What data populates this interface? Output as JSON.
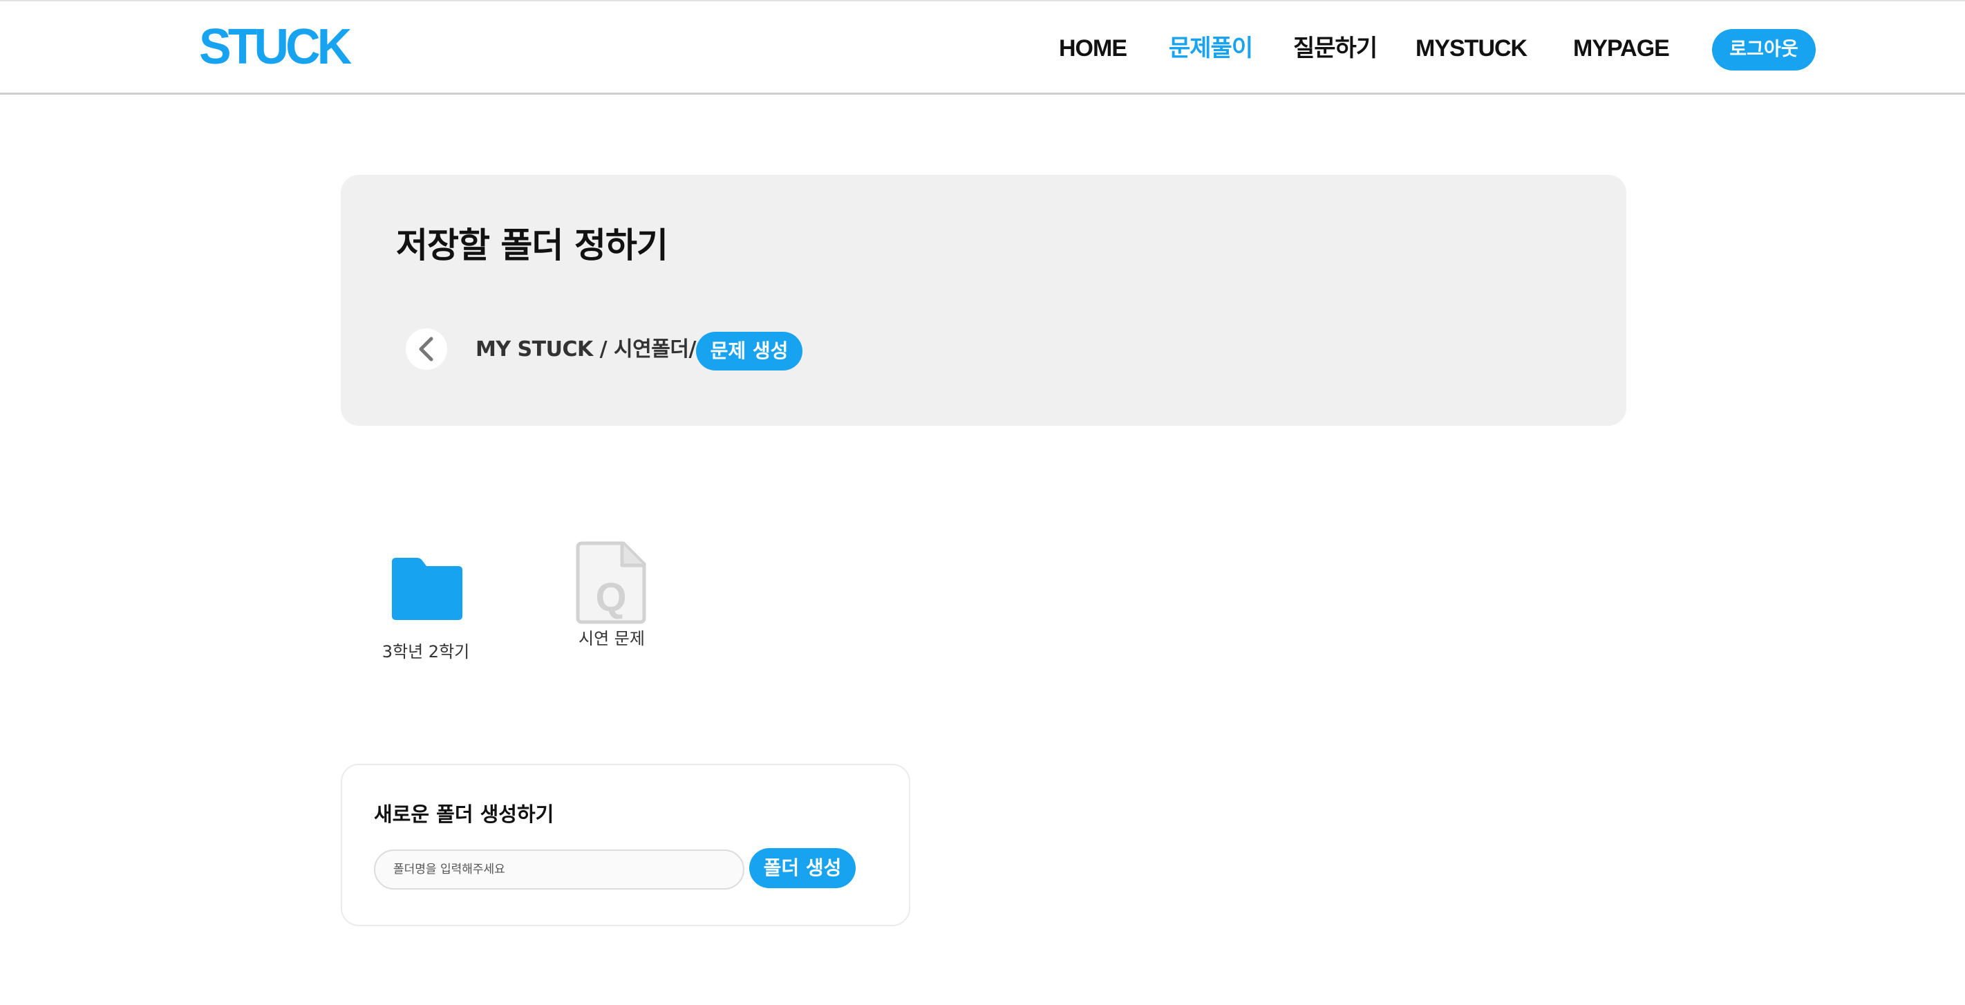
{
  "header": {
    "logo": "STUCK",
    "nav": [
      {
        "label": "HOME",
        "active": false
      },
      {
        "label": "문제풀이",
        "active": true
      },
      {
        "label": "질문하기",
        "active": false
      },
      {
        "label": "MYSTUCK",
        "active": false
      },
      {
        "label": "MYPAGE",
        "active": false
      }
    ],
    "logout_label": "로그아웃"
  },
  "panel": {
    "title": "저장할 폴더 정하기",
    "breadcrumb": "MY STUCK / 시연폴더/",
    "action_label": "문제 생성"
  },
  "items": [
    {
      "type": "folder",
      "icon": "folder-icon",
      "label": "3학년 2학기"
    },
    {
      "type": "question",
      "icon": "question-file-icon",
      "label": "시연 문제"
    }
  ],
  "new_folder": {
    "title": "새로운 폴더 생성하기",
    "input_value": "",
    "input_placeholder": "폴더명을 입력해주세요",
    "button_label": "폴더 생성"
  },
  "colors": {
    "accent": "#17a3f0",
    "panel_bg": "#f0f0f0"
  }
}
